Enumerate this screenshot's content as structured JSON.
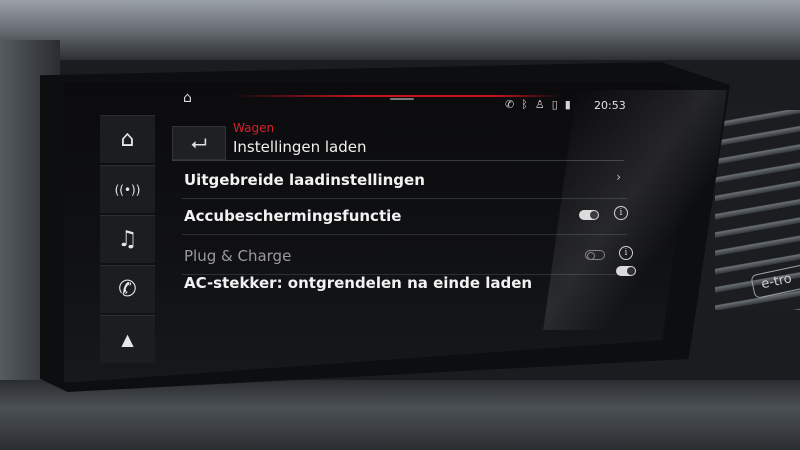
{
  "status_bar": {
    "icons": [
      "home-icon",
      "phone-bluetooth-icon",
      "bluetooth-icon",
      "person-icon",
      "phone-icon",
      "signal-icon"
    ],
    "time": "20:53"
  },
  "sidebar": {
    "items": [
      {
        "icon": "home-icon",
        "glyph": "⌂"
      },
      {
        "icon": "radio-icon",
        "glyph": "((•))"
      },
      {
        "icon": "music-note-icon",
        "glyph": "♫"
      },
      {
        "icon": "phone-icon",
        "glyph": "✆"
      },
      {
        "icon": "navigation-icon",
        "glyph": "▲"
      }
    ]
  },
  "header": {
    "back_glyph": "⮠",
    "breadcrumb": "Wagen",
    "title": "Instellingen laden"
  },
  "rows": [
    {
      "label": "Uitgebreide laadinstellingen",
      "type": "link"
    },
    {
      "label": "Accubeschermingsfunctie",
      "type": "toggle",
      "state": "on",
      "info": true
    },
    {
      "label": "Plug & Charge",
      "type": "toggle",
      "state": "off",
      "info": true,
      "disabled": true
    },
    {
      "label": "AC-stekker: ontgrendelen na einde laden",
      "type": "toggle",
      "state": "on",
      "info": false
    }
  ],
  "info_glyph": "i",
  "chevron_glyph": "›",
  "car_badge": "e-tro",
  "colors": {
    "accent_red": "#d61f2c",
    "text": "#f2f2f2",
    "disabled_text": "#9a9a9a"
  }
}
